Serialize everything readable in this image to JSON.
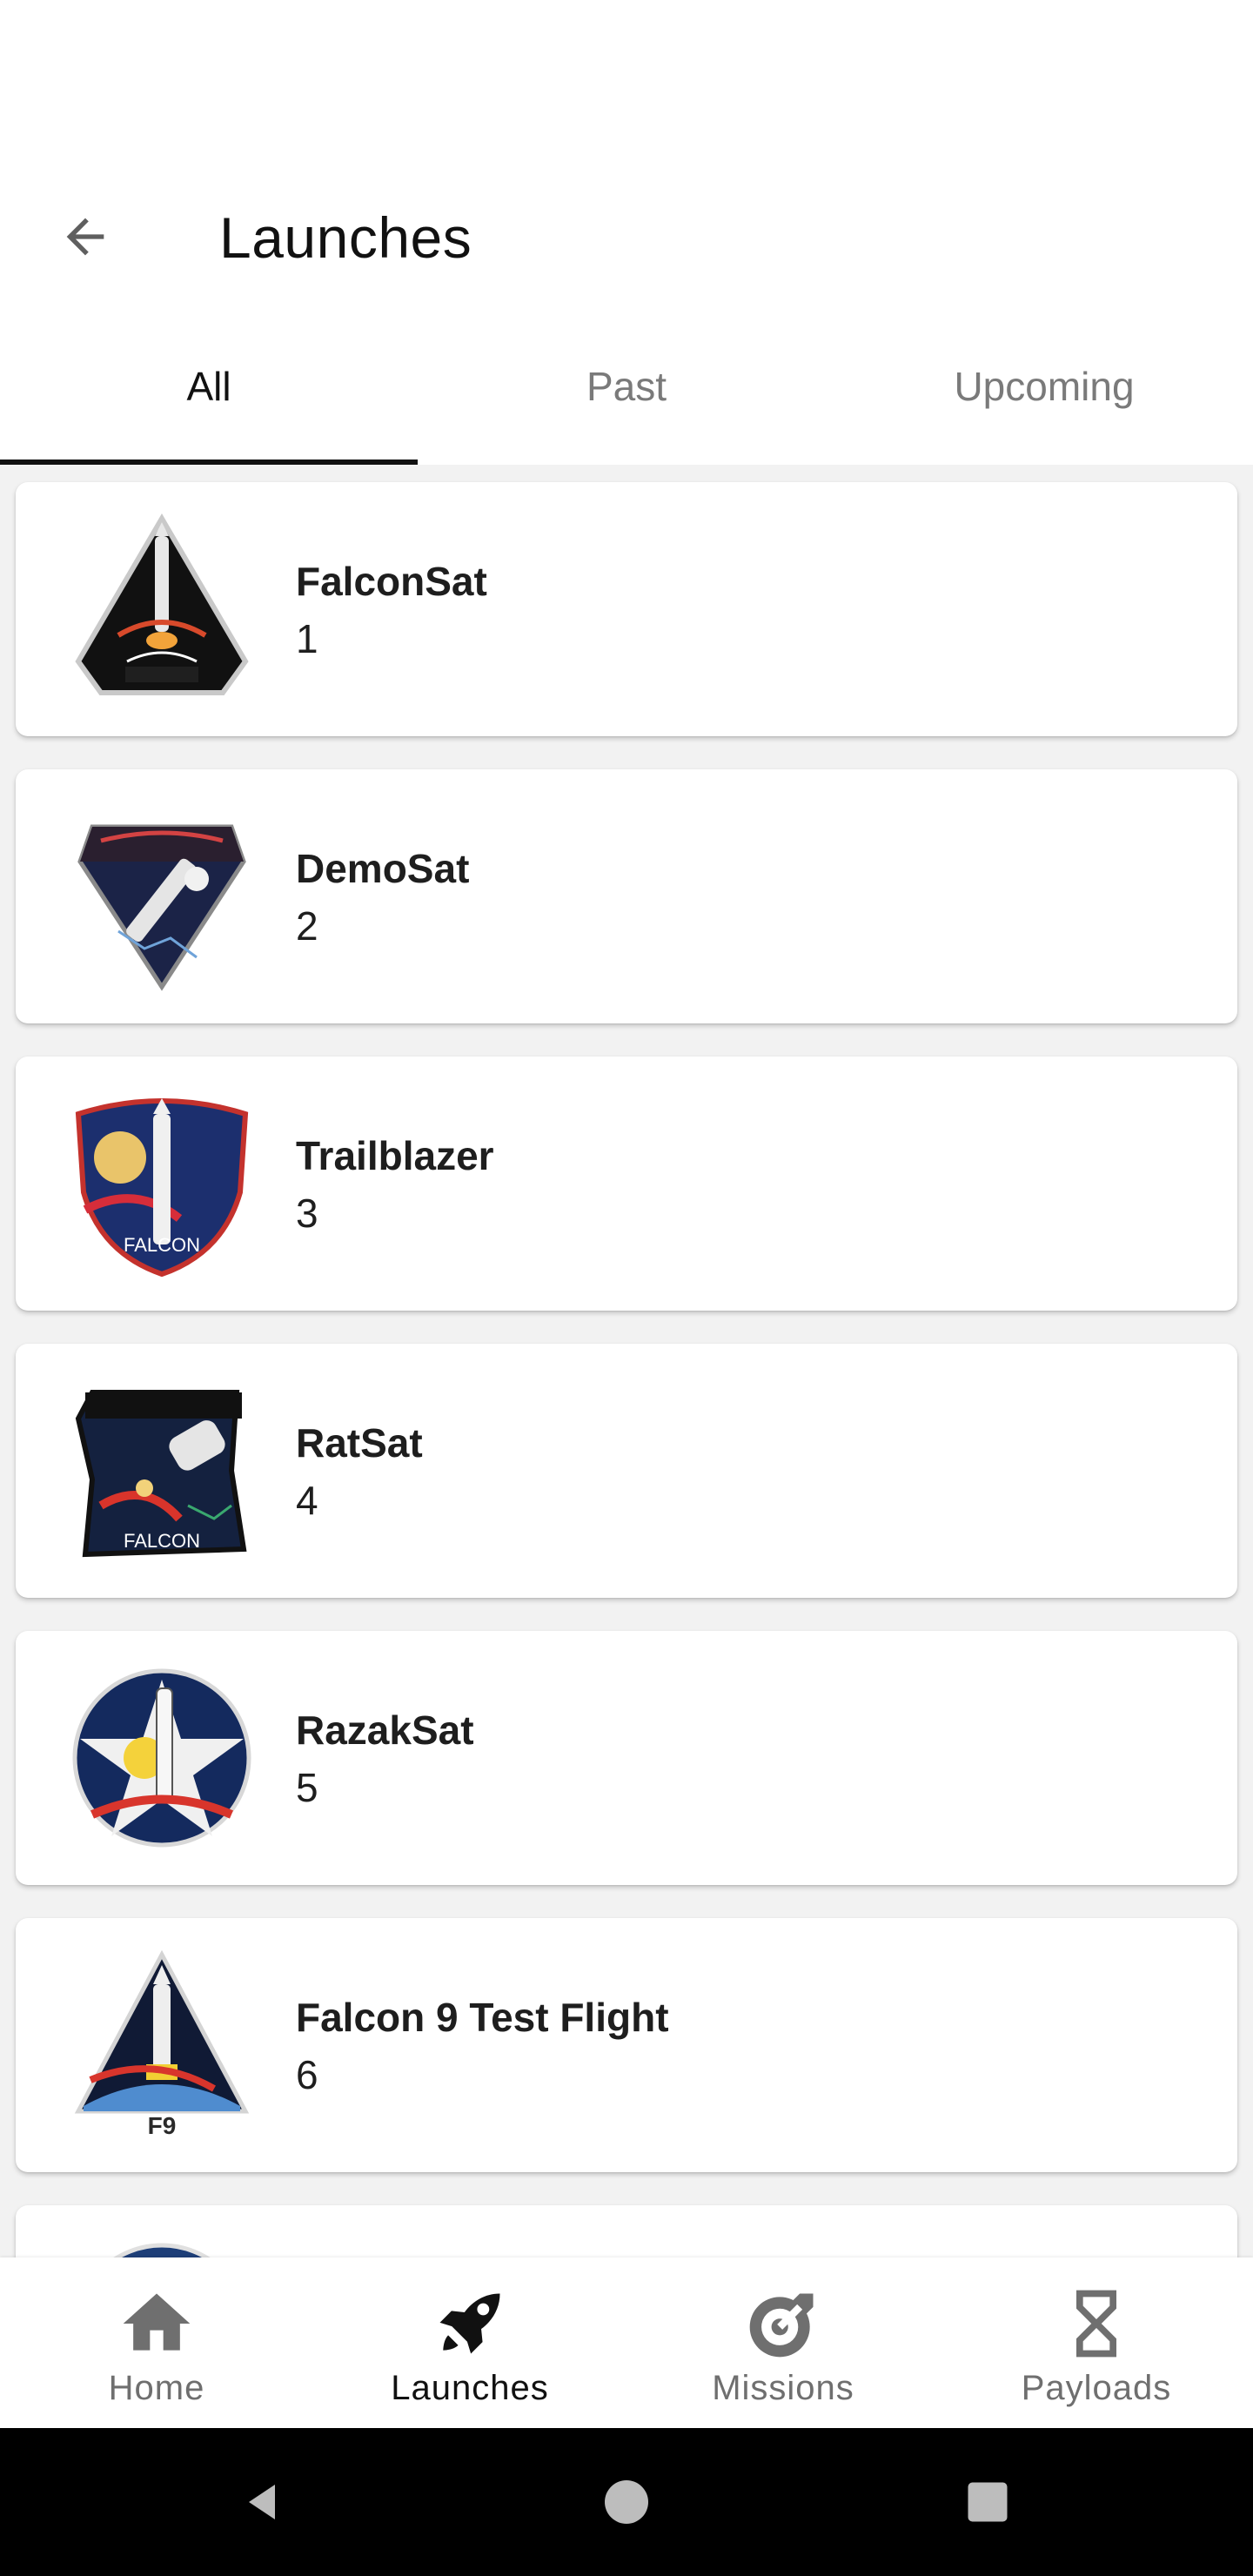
{
  "header": {
    "title": "Launches",
    "back_icon": "arrow-left-icon"
  },
  "tabs": [
    {
      "label": "All",
      "active": true
    },
    {
      "label": "Past",
      "active": false
    },
    {
      "label": "Upcoming",
      "active": false
    }
  ],
  "launches": [
    {
      "name": "FalconSat",
      "number": "1",
      "patch_icon": "falconsat-mission-patch"
    },
    {
      "name": "DemoSat",
      "number": "2",
      "patch_icon": "demosat-mission-patch"
    },
    {
      "name": "Trailblazer",
      "number": "3",
      "patch_icon": "trailblazer-mission-patch"
    },
    {
      "name": "RatSat",
      "number": "4",
      "patch_icon": "ratsat-mission-patch"
    },
    {
      "name": "RazakSat",
      "number": "5",
      "patch_icon": "razaksat-mission-patch"
    },
    {
      "name": "Falcon 9 Test Flight",
      "number": "6",
      "patch_icon": "falcon9-test-flight-mission-patch"
    }
  ],
  "bottom_nav": [
    {
      "label": "Home",
      "icon": "home-icon",
      "active": false
    },
    {
      "label": "Launches",
      "icon": "rocket-icon",
      "active": true
    },
    {
      "label": "Missions",
      "icon": "target-icon",
      "active": false
    },
    {
      "label": "Payloads",
      "icon": "hourglass-icon",
      "active": false
    }
  ],
  "system_nav": {
    "back_icon": "triangle-back-icon",
    "home_icon": "circle-home-icon",
    "recents_icon": "square-recents-icon"
  },
  "colors": {
    "active_text": "#111111",
    "inactive_text": "#7a7a7a",
    "list_background": "#f2f2f2",
    "system_bar": "#000000"
  }
}
